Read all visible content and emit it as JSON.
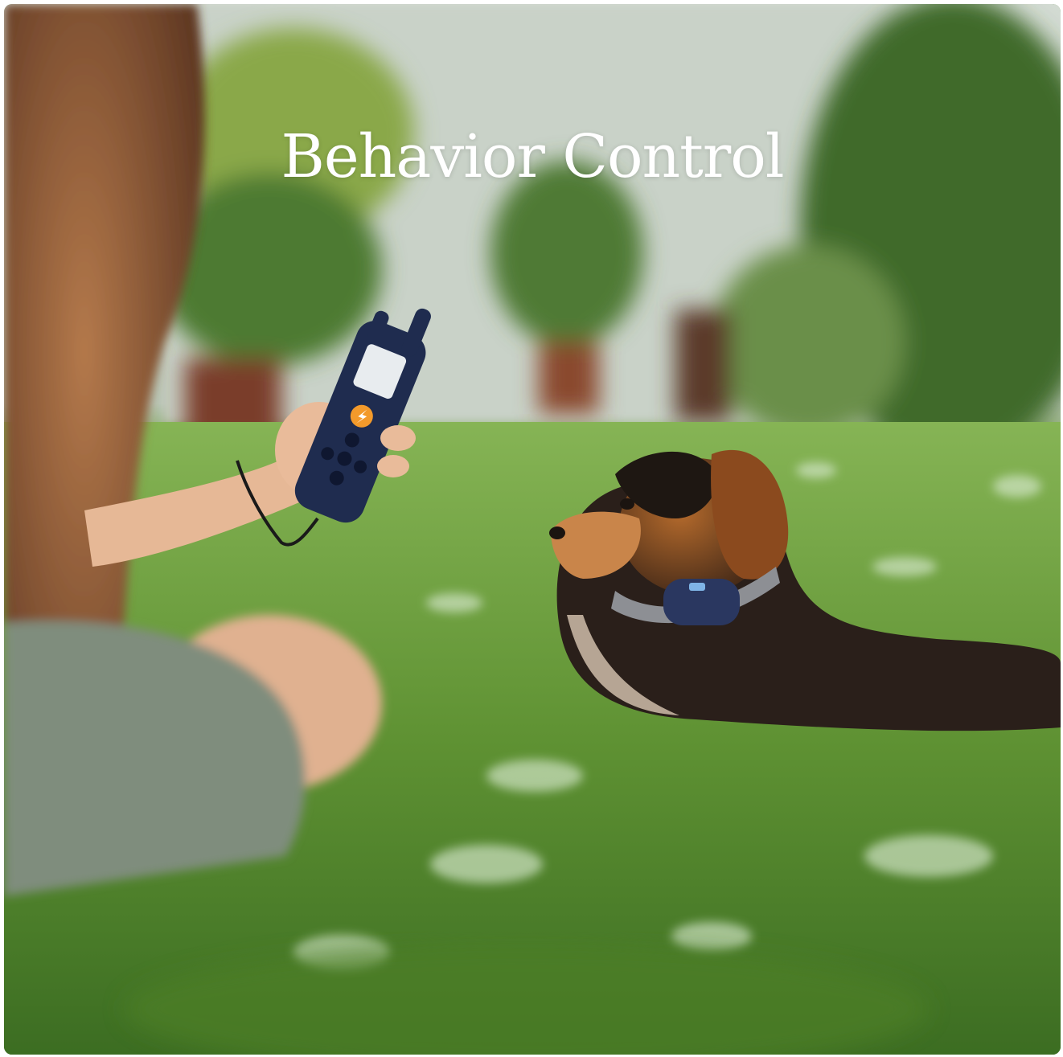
{
  "headline": "Behavior Control",
  "palette": {
    "wall": "#cfd6cf",
    "foliage": "#4f7a2c",
    "grass": "#6a9a3a",
    "remote_body": "#1f2c4f",
    "remote_button": "#f39a2b",
    "collar": "#2a3760",
    "dog_fur": "#8b4a1e",
    "dog_dark": "#2a1f1a"
  },
  "icons": {
    "remote": "remote-trainer-icon",
    "collar": "collar-receiver-icon"
  }
}
